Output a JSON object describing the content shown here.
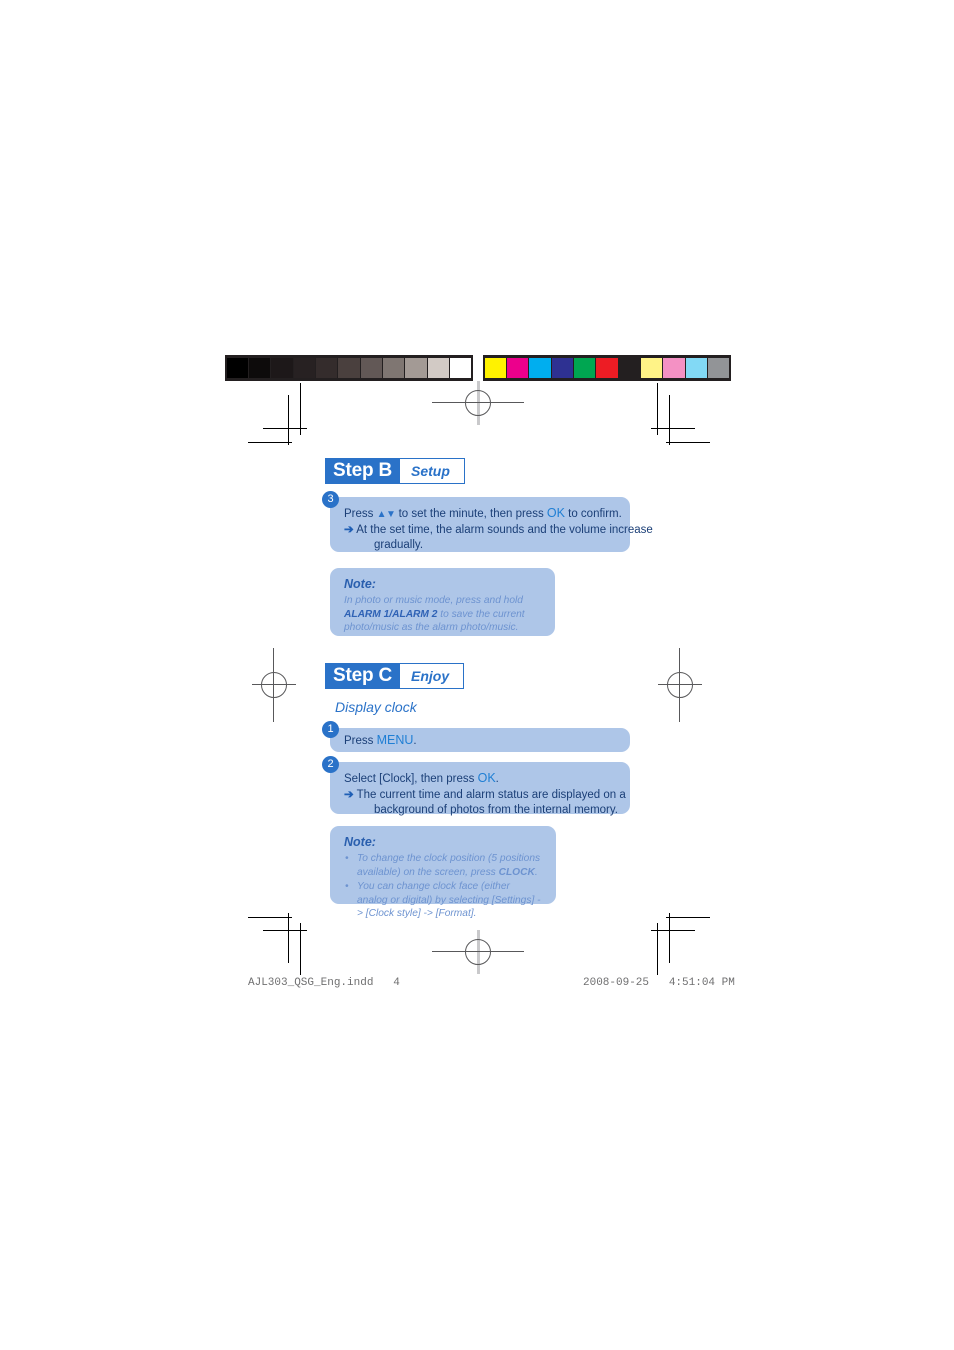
{
  "proof_marks": {
    "grayscale_bar": {
      "frame_color": "#231f20",
      "swatches": [
        "#000000",
        "#0d0b0b",
        "#1d1819",
        "#272122",
        "#342c2c",
        "#4a403e",
        "#625856",
        "#7f7672",
        "#a39a95",
        "#d2cac5",
        "#ffffff"
      ]
    },
    "color_bar": {
      "frame_color": "#231f20",
      "swatches": [
        "#fff200",
        "#ec008c",
        "#00aeef",
        "#2e3192",
        "#00a651",
        "#ed1c24",
        "#231f20",
        "#fff387",
        "#f491c4",
        "#82d9f5",
        "#929497"
      ]
    }
  },
  "step_b": {
    "label": "Step B",
    "action": "Setup",
    "badge": "3",
    "instruction_main_pre": "Press ",
    "instruction_triangles": "▲▼",
    "instruction_main_mid": " to set the minute, then press ",
    "instruction_key": "OK",
    "instruction_main_post": " to confirm.",
    "arrow": "➔",
    "result_line1": "At the set time, the alarm sounds and the volume increase",
    "result_line2": "gradually.",
    "note": {
      "title": "Note:",
      "text_part1": "In photo or music mode, press and hold ",
      "text_bold1": "ALARM",
      "text_bold2": "1/ALARM 2",
      "text_part2": " to save the current photo/music as the",
      "text_part3": "alarm photo/music."
    }
  },
  "step_c": {
    "label": "Step C",
    "action": "Enjoy",
    "sub_heading": "Display clock",
    "step1": {
      "badge": "1",
      "text_pre": "Press ",
      "key": "MENU",
      "text_post": "."
    },
    "step2": {
      "badge": "2",
      "text_pre": "Select [Clock], then press ",
      "key": "OK",
      "text_post": ".",
      "arrow": "➔",
      "result_line1": "The current time and alarm status are displayed on a",
      "result_line2": "background of photos from the internal memory."
    },
    "note": {
      "title": "Note:",
      "bullet_char": "•",
      "bullet1_line1": "To change the clock position (5 positions available)",
      "bullet1_line2_pre": "on the screen, press ",
      "bullet1_bold": "CLOCK",
      "bullet1_line2_post": ".",
      "bullet2_line1": "You can change clock face (either analog or digital)",
      "bullet2_line2": "by selecting [Settings] -> [Clock style] -> [Format]."
    }
  },
  "footer": {
    "filename": "AJL303_QSG_Eng.indd   4",
    "timestamp": "2008-09-25   4:51:04 PM"
  },
  "colors": {
    "brand_blue": "#2a72c8",
    "box_fill": "#aec6e8",
    "body_navy": "#1b3f77",
    "note_text": "#6d93d0",
    "mark_black": "#000000",
    "reg_gray": "#58585a"
  }
}
